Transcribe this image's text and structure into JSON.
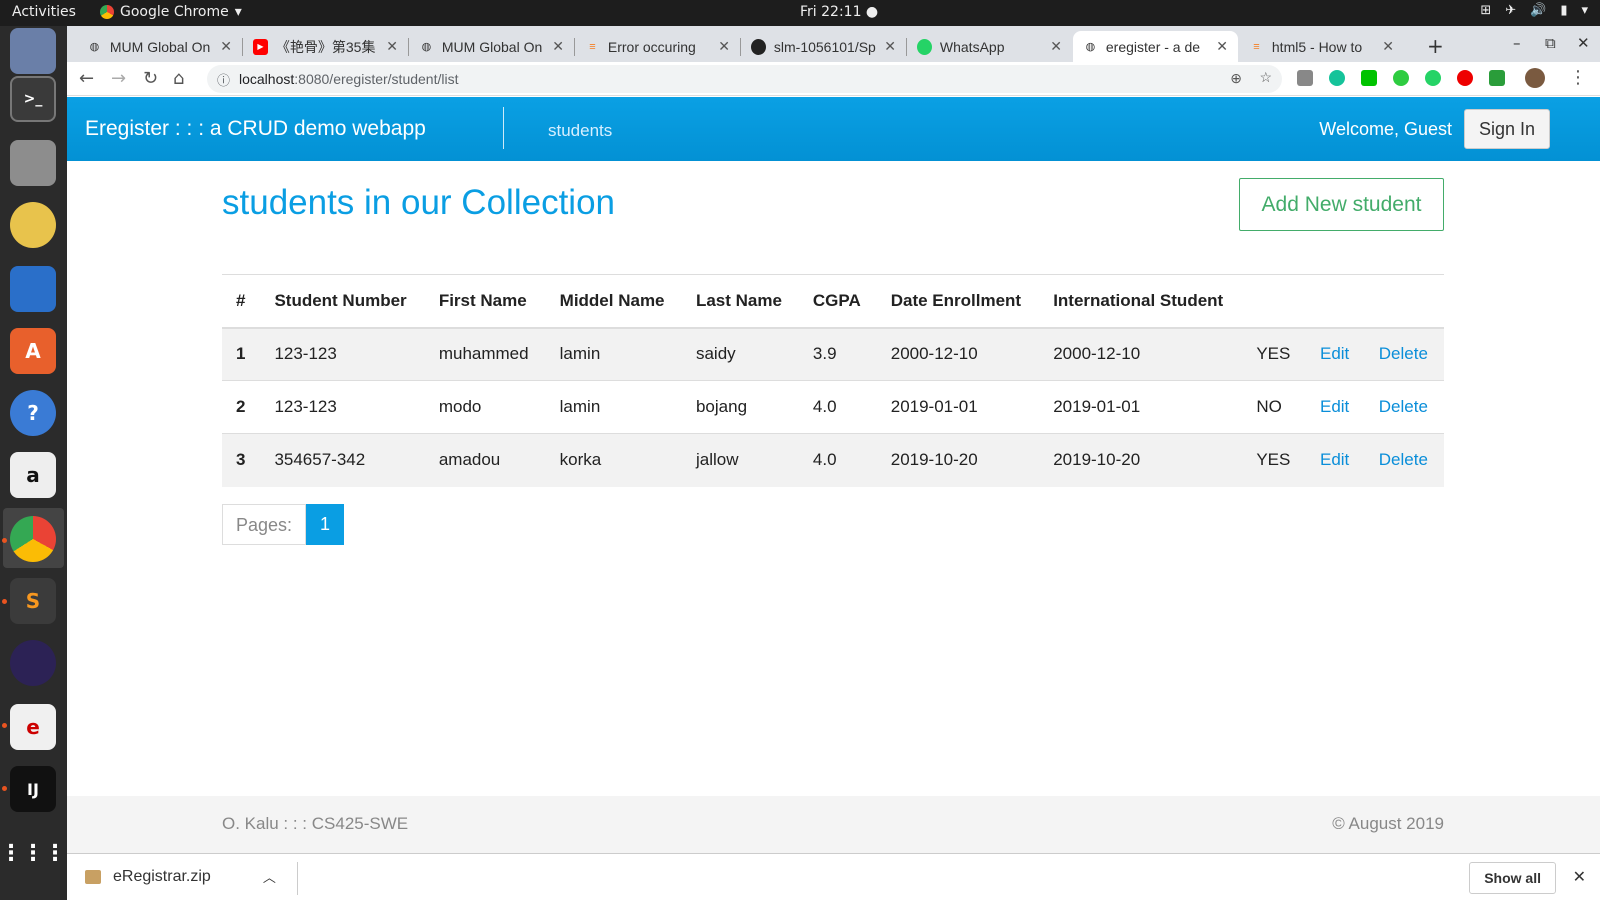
{
  "system": {
    "activities": "Activities",
    "app_name": "Google Chrome",
    "clock": "Fri 22:11"
  },
  "tabs": [
    {
      "title": "MUM Global On",
      "active": false
    },
    {
      "title": "《艳骨》第35集",
      "active": false
    },
    {
      "title": "MUM Global On",
      "active": false
    },
    {
      "title": "Error occuring",
      "active": false
    },
    {
      "title": "slm-1056101/Sp",
      "active": false
    },
    {
      "title": "WhatsApp",
      "active": false
    },
    {
      "title": "eregister - a de",
      "active": true
    },
    {
      "title": "html5 - How to",
      "active": false
    }
  ],
  "address_bar": {
    "host": "localhost",
    "path": ":8080/eregister/student/list"
  },
  "navbar": {
    "brand": "Eregister : : : a CRUD demo webapp",
    "link": "students",
    "welcome": "Welcome, Guest",
    "signin": "Sign In"
  },
  "page": {
    "heading": "students in our Collection",
    "add_button": "Add New student"
  },
  "table": {
    "headers": [
      "#",
      "Student Number",
      "First Name",
      "Middel Name",
      "Last Name",
      "CGPA",
      "Date Enrollment",
      "International Student"
    ],
    "rows": [
      {
        "num": "1",
        "student_number": "123-123",
        "first": "muhammed",
        "middle": "lamin",
        "last": "saidy",
        "cgpa": "3.9",
        "enrolled": "2000-12-10",
        "intl_date": "2000-12-10",
        "intl": "YES",
        "edit": "Edit",
        "delete": "Delete"
      },
      {
        "num": "2",
        "student_number": "123-123",
        "first": "modo",
        "middle": "lamin",
        "last": "bojang",
        "cgpa": "4.0",
        "enrolled": "2019-01-01",
        "intl_date": "2019-01-01",
        "intl": "NO",
        "edit": "Edit",
        "delete": "Delete"
      },
      {
        "num": "3",
        "student_number": "354657-342",
        "first": "amadou",
        "middle": "korka",
        "last": "jallow",
        "cgpa": "4.0",
        "enrolled": "2019-10-20",
        "intl_date": "2019-10-20",
        "intl": "YES",
        "edit": "Edit",
        "delete": "Delete"
      }
    ]
  },
  "pager": {
    "label": "Pages:",
    "current": "1"
  },
  "footer": {
    "left": "O. Kalu : : : CS425-SWE",
    "right": "© August 2019"
  },
  "downloads": {
    "file": "eRegistrar.zip",
    "show_all": "Show all"
  },
  "colors": {
    "navbar": "#0aa0e4",
    "heading": "#0a9ee3",
    "add_button": "#43ac6a",
    "link": "#0a8ed9"
  }
}
